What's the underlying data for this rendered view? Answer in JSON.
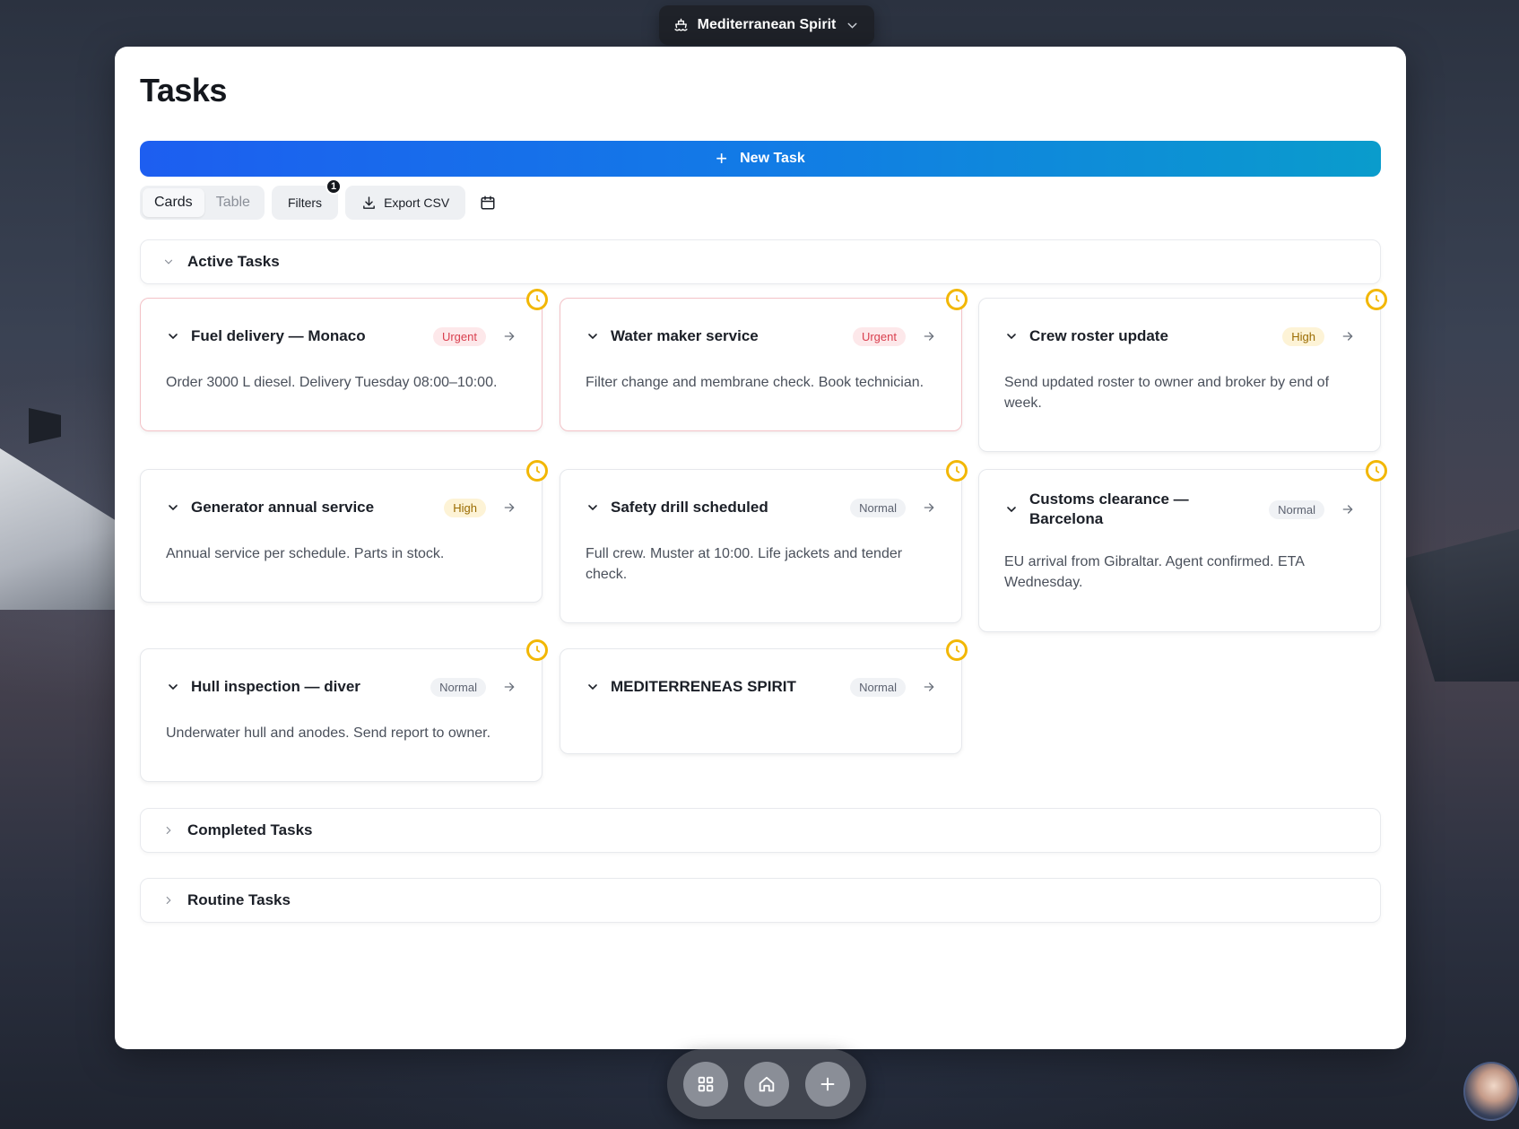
{
  "vessel": {
    "name": "Mediterranean Spirit"
  },
  "page": {
    "title": "Tasks"
  },
  "new_task": {
    "label": "New Task"
  },
  "toolbar": {
    "view_cards": "Cards",
    "view_table": "Table",
    "filters_label": "Filters",
    "filters_count": "1",
    "export_label": "Export CSV"
  },
  "sections": {
    "active": "Active Tasks",
    "completed": "Completed Tasks",
    "routine": "Routine Tasks"
  },
  "tasks": [
    {
      "title": "Fuel delivery — Monaco",
      "priority": "Urgent",
      "description": "Order 3000 L diesel. Delivery Tuesday 08:00–10:00."
    },
    {
      "title": "Water maker service",
      "priority": "Urgent",
      "description": "Filter change and membrane check. Book technician."
    },
    {
      "title": "Crew roster update",
      "priority": "High",
      "description": "Send updated roster to owner and broker by end of week."
    },
    {
      "title": "Generator annual service",
      "priority": "High",
      "description": "Annual service per schedule. Parts in stock."
    },
    {
      "title": "Safety drill scheduled",
      "priority": "Normal",
      "description": "Full crew. Muster at 10:00. Life jackets and tender check."
    },
    {
      "title": "Customs clearance — Barcelona",
      "priority": "Normal",
      "description": "EU arrival from Gibraltar. Agent confirmed. ETA Wednesday."
    },
    {
      "title": "Hull inspection — diver",
      "priority": "Normal",
      "description": "Underwater hull and anodes. Send report to owner."
    },
    {
      "title": "MEDITERRENEAS SPIRIT",
      "priority": "Normal",
      "description": ""
    }
  ],
  "colors": {
    "accent_start": "#1d5ef0",
    "accent_end": "#0a9ccc",
    "urgent": "#d9404f",
    "high": "#9a6b00",
    "clock": "#f2b705"
  }
}
